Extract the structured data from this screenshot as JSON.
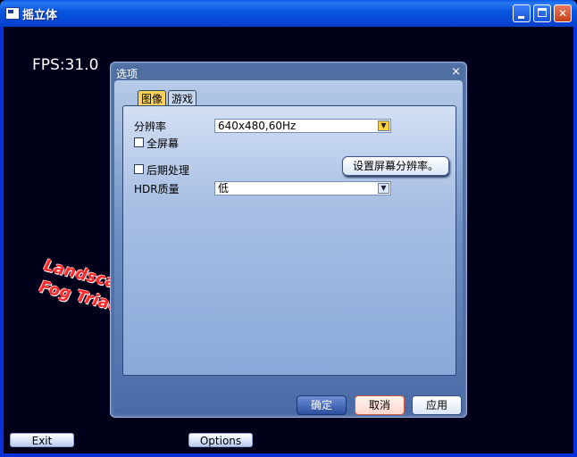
{
  "window": {
    "title": "摇立体",
    "icon": "app-window-icon",
    "controls": [
      "minimize-icon",
      "maximize-icon",
      "close-icon"
    ]
  },
  "overlay": {
    "fps": "FPS:31.0",
    "background_text": [
      "Landscap",
      "Fog Trian"
    ]
  },
  "bottom_buttons": {
    "exit": "Exit",
    "options": "Options"
  },
  "dialog": {
    "title": "选项",
    "close": "×",
    "tabs": [
      {
        "label": "图像",
        "active": true
      },
      {
        "label": "游戏",
        "active": false
      }
    ],
    "fields": {
      "resolution_label": "分辨率",
      "resolution_value": "640x480,60Hz",
      "fullscreen_label": "全屏幕",
      "postprocess_label": "后期处理",
      "hdr_label": "HDR质量",
      "hdr_value": "低"
    },
    "set_resolution_button": "设置屏幕分辨率。",
    "buttons": {
      "ok": "确定",
      "cancel": "取消",
      "apply": "应用"
    }
  },
  "colors": {
    "titlebar": "#0a58e0",
    "dialog_frame": "#4f6fa3",
    "tab_active": "#ffd35a",
    "cancel_border": "#d05a3a",
    "overlay_text": "#ff2a2a"
  }
}
